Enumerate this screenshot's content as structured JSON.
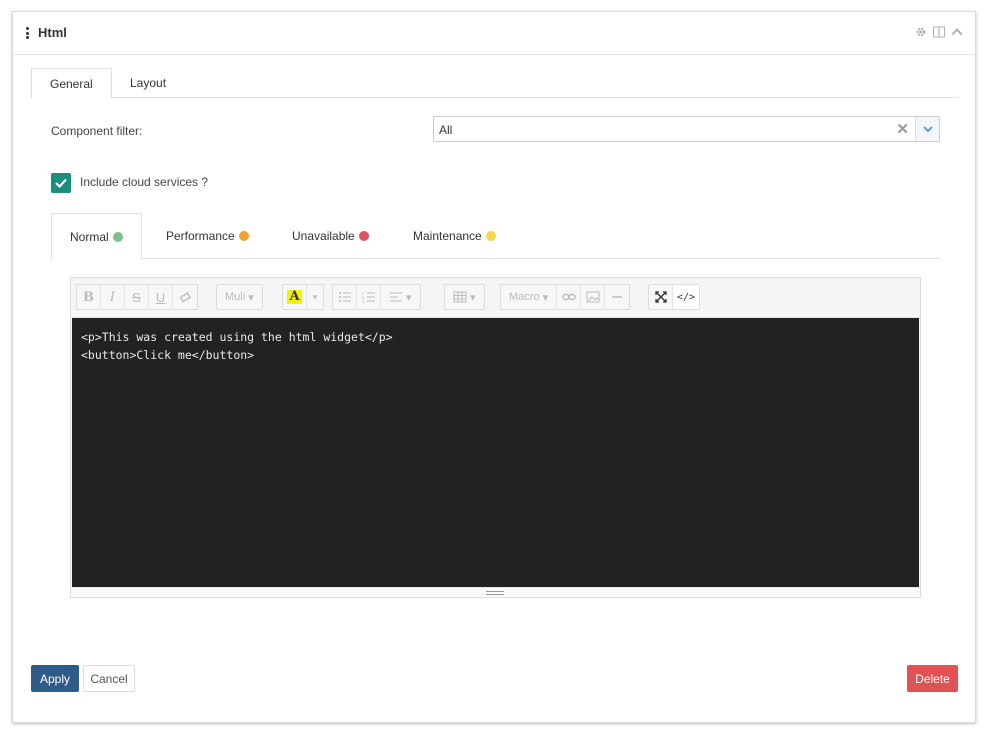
{
  "header": {
    "title": "Html"
  },
  "top_tabs": [
    {
      "label": "General",
      "active": true
    },
    {
      "label": "Layout",
      "active": false
    }
  ],
  "filter": {
    "label": "Component filter:",
    "value": "All",
    "clear_symbol": "✕"
  },
  "cloud": {
    "label": "Include cloud services ?",
    "checked": true
  },
  "status_tabs": [
    {
      "label": "Normal",
      "color": "#7cc08c",
      "active": true
    },
    {
      "label": "Performance",
      "color": "#f0a030",
      "active": false
    },
    {
      "label": "Unavailable",
      "color": "#e05260",
      "active": false
    },
    {
      "label": "Maintenance",
      "color": "#f5d84a",
      "active": false
    }
  ],
  "toolbar": {
    "font_label": "Muli",
    "macro_label": "Macro",
    "highlight_letter": "A",
    "codeview_label": "</>"
  },
  "editor": {
    "lines": [
      "<p>This was created using the html widget</p>",
      "<button>Click me</button>"
    ]
  },
  "actions": {
    "apply": "Apply",
    "cancel": "Cancel",
    "delete": "Delete"
  },
  "colors": {
    "apply": "#2f5b88",
    "delete": "#e05254",
    "checkbox": "#1b8f7b"
  }
}
